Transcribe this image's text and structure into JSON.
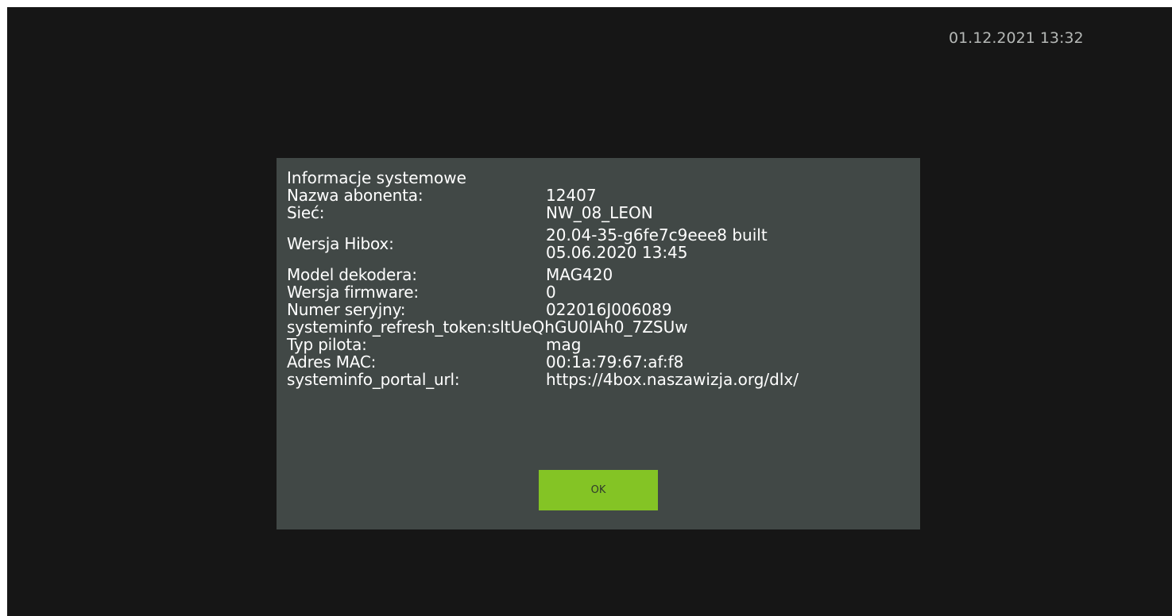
{
  "clock": "01.12.2021 13:32",
  "dialog": {
    "title": "Informacje systemowe",
    "rows": [
      {
        "label": "Nazwa abonenta:",
        "value": "12407"
      },
      {
        "label": "Sieć:",
        "value": "NW_08_LEON"
      },
      {
        "label": "Wersja Hibox:",
        "value_line1": "20.04-35-g6fe7c9eee8 built",
        "value_line2": "05.06.2020 13:45"
      },
      {
        "label": "Model dekodera:",
        "value": "MAG420"
      },
      {
        "label": "Wersja firmware:",
        "value": "0"
      },
      {
        "label": "Numer seryjny:",
        "value": "022016J006089"
      },
      {
        "label": "systeminfo_refresh_token:",
        "value": "sltUeQhGU0lAh0_7ZSUw"
      },
      {
        "label": "Typ pilota:",
        "value": "mag"
      },
      {
        "label": "Adres MAC:",
        "value": "00:1a:79:67:af:f8"
      },
      {
        "label": "systeminfo_portal_url:",
        "value": "https://4box.naszawizja.org/dlx/"
      }
    ],
    "ok_label": "OK"
  }
}
